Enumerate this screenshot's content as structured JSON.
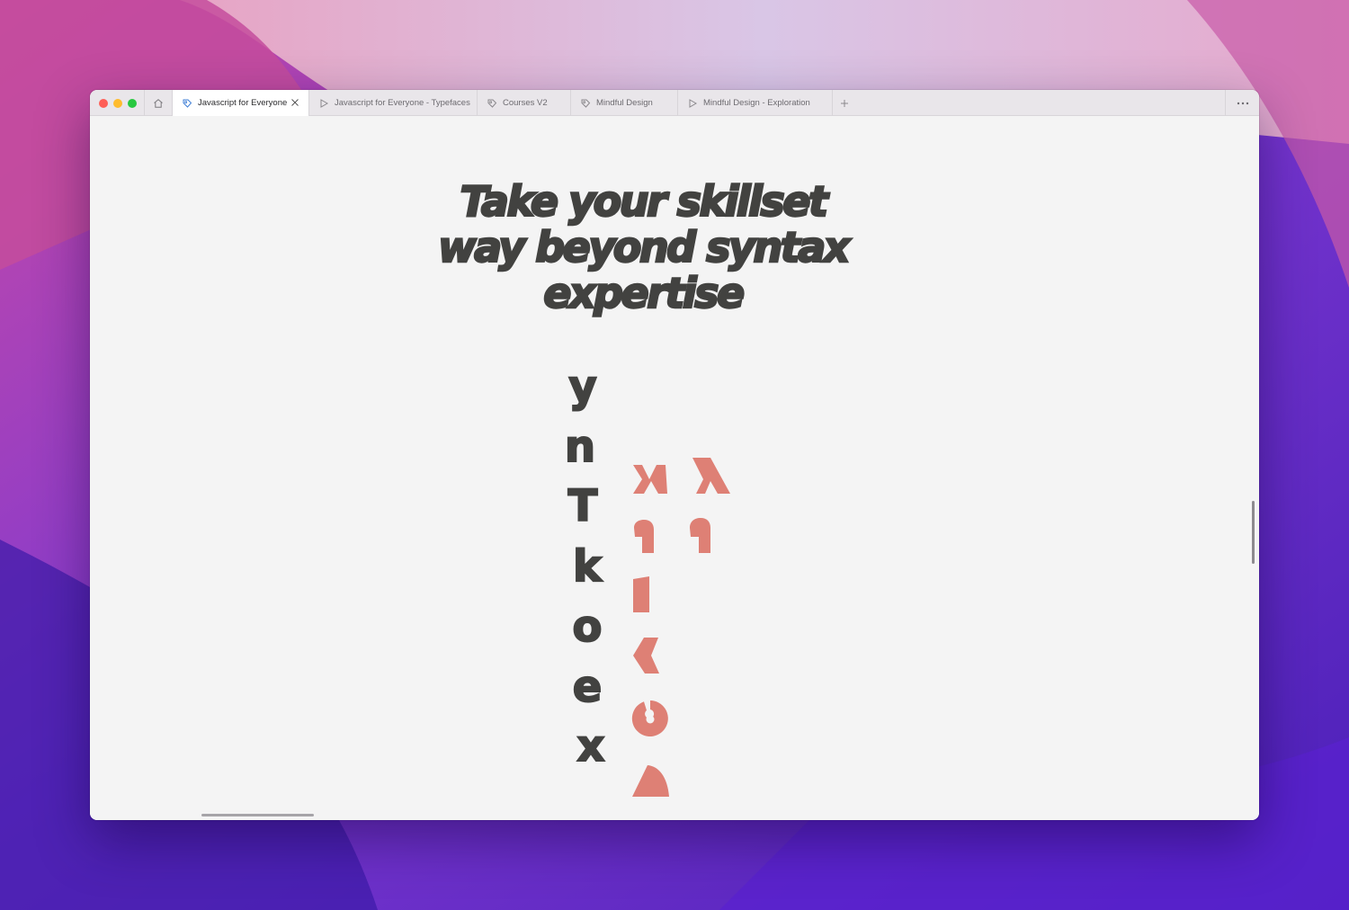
{
  "browser": {
    "tabs": [
      {
        "label": "Javascript for Everyone",
        "icon": "course-tag-icon",
        "active": true
      },
      {
        "label": "Javascript for Everyone - Typefaces",
        "icon": "play-icon",
        "active": false
      },
      {
        "label": "Courses V2",
        "icon": "course-tag-icon",
        "active": false
      },
      {
        "label": "Mindful Design",
        "icon": "course-tag-icon",
        "active": false
      },
      {
        "label": "Mindful Design - Exploration",
        "icon": "play-icon",
        "active": false
      }
    ],
    "buttons": {
      "home": "home-icon",
      "close_tab": "close-icon",
      "new_tab": "plus-icon",
      "more": "ellipsis-icon"
    }
  },
  "page": {
    "headline_lines": [
      "Take your skillset",
      "way beyond syntax",
      "expertise"
    ],
    "glyph_column": [
      "y",
      "n",
      "T",
      "k",
      "o",
      "e",
      "x"
    ]
  },
  "colors": {
    "ink": "#424240",
    "accent": "#de8075",
    "page_bg": "#f4f4f4"
  }
}
